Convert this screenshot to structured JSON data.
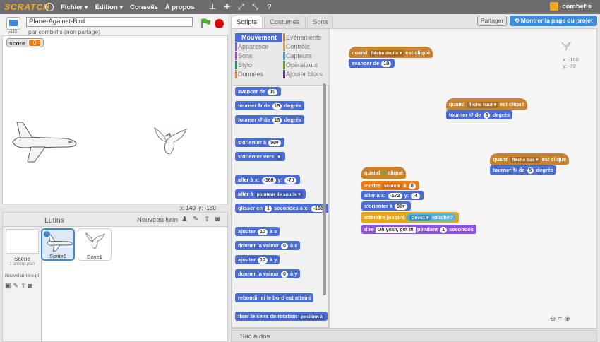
{
  "app": {
    "logo_text": "SCRATCH",
    "menus": [
      "Fichier ▾",
      "Édition ▾",
      "Conseils",
      "À propos"
    ],
    "user": "combefis"
  },
  "project": {
    "title": "Plane-Against-Bird",
    "owner": "par combefis (non partagé)",
    "version_label": "v440"
  },
  "stage": {
    "monitor_label": "score",
    "monitor_value": "0",
    "coords_x_label": "x:",
    "coords_x": "140",
    "coords_y_label": "y:",
    "coords_y": "-180"
  },
  "sprites_panel": {
    "title": "Lutins",
    "new_sprite_label": "Nouveau lutin",
    "scene_label": "Scène",
    "scene_sub": "1 arrière-plan",
    "backdrop_label": "Nouvel arrière-pl",
    "sprites": [
      {
        "name": "Sprite1",
        "selected": true
      },
      {
        "name": "Dove1",
        "selected": false
      }
    ]
  },
  "tabs": [
    "Scripts",
    "Costumes",
    "Sons"
  ],
  "header_buttons": {
    "share": "Partager",
    "project_page": "Montrer la page du projet"
  },
  "categories": {
    "left": [
      "Mouvement",
      "Apparence",
      "Sons",
      "Stylo",
      "Données"
    ],
    "right": [
      "Evénements",
      "Contrôle",
      "Capteurs",
      "Opérateurs",
      "Ajouter blocs"
    ],
    "colors_left": [
      "#4a6cd4",
      "#8a55d7",
      "#bb42c3",
      "#0e9a6c",
      "#ee7d16"
    ],
    "colors_right": [
      "#c88330",
      "#e1a91a",
      "#2ca5e2",
      "#5cb712",
      "#632d99"
    ]
  },
  "palette_blocks": {
    "b1": [
      "avancer de",
      "10"
    ],
    "b2": [
      "tourner",
      "de",
      "15",
      "degrés"
    ],
    "b3": [
      "tourner",
      "de",
      "15",
      "degrés"
    ],
    "b4": [
      "s'orienter à",
      "90▾"
    ],
    "b5": [
      "s'orienter vers",
      "▾"
    ],
    "b6": [
      "aller à x:",
      "-168",
      "y:",
      "-70"
    ],
    "b7": [
      "aller à",
      "pointeur de souris ▾"
    ],
    "b8": [
      "glisser en",
      "1",
      "secondes à x:",
      "-168"
    ],
    "b9": [
      "ajouter",
      "10",
      "à x"
    ],
    "b10": [
      "donner la valeur",
      "0",
      "à x"
    ],
    "b11": [
      "ajouter",
      "10",
      "à y"
    ],
    "b12": [
      "donner la valeur",
      "0",
      "à y"
    ],
    "b13": "rebondir si le bord est atteint",
    "b14": [
      "fixer le sens de rotation",
      "position à"
    ]
  },
  "scripts": {
    "s1": {
      "hat": [
        "quand",
        "flèche droite ▾",
        "est cliqué"
      ],
      "cmd": [
        "avancer de",
        "10"
      ]
    },
    "s2": {
      "hat": [
        "quand",
        "flèche haut ▾",
        "est cliqué"
      ],
      "cmd": [
        "tourner",
        "de",
        "5",
        "degrés"
      ]
    },
    "s3": {
      "hat": [
        "quand",
        "flèche bas ▾",
        "est cliqué"
      ],
      "cmd": [
        "tourner",
        "de",
        "5",
        "degrés"
      ]
    },
    "s4": {
      "hat": [
        "quand",
        "cliqué"
      ],
      "set": [
        "mettre",
        "score ▾",
        "à",
        "0"
      ],
      "goto": [
        "aller à x:",
        "-172",
        "y:",
        "-4"
      ],
      "orient": [
        "s'orienter à",
        "90▾"
      ],
      "wait": [
        "attendre jusqu'à",
        "Dove1 ▾",
        "touché?"
      ],
      "say": [
        "dire",
        "Oh yeah, got it!",
        "pendant",
        "1",
        "secondes"
      ]
    }
  },
  "script_area_coords": {
    "x": "x: -168",
    "y": "y: -70"
  },
  "backpack_label": "Sac à dos"
}
